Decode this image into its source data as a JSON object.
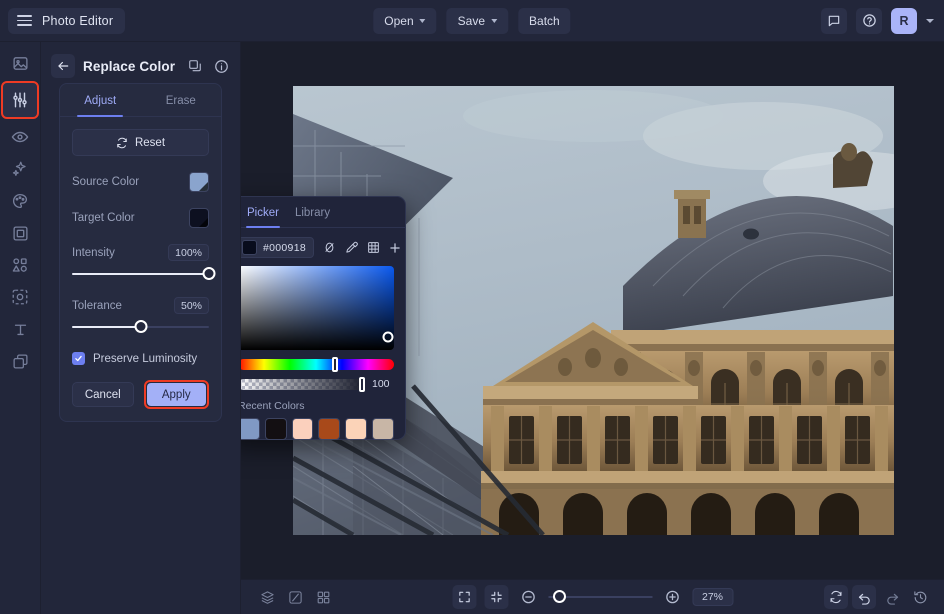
{
  "app": {
    "brand": "Photo Editor",
    "accent": "#6d7ff0",
    "highlight": "#ef3b24",
    "bg": "#22263a",
    "canvas_bg": "#1b1e2b"
  },
  "topbar": {
    "menu_icon": "hamburger-icon",
    "buttons": [
      {
        "label": "Open",
        "has_caret": true
      },
      {
        "label": "Save",
        "has_caret": true
      },
      {
        "label": "Batch",
        "has_caret": false
      }
    ],
    "right_icons": [
      "comment-icon",
      "help-icon"
    ],
    "avatar_initial": "R"
  },
  "rail": {
    "items": [
      {
        "name": "image-icon",
        "active": false
      },
      {
        "name": "adjustments-icon",
        "active": true
      },
      {
        "name": "eye-icon",
        "active": false
      },
      {
        "name": "sparkles-icon",
        "active": false
      },
      {
        "name": "palette-icon",
        "active": false
      },
      {
        "name": "frame-icon",
        "active": false
      },
      {
        "name": "shapes-icon",
        "active": false
      },
      {
        "name": "effects-icon",
        "active": false
      },
      {
        "name": "text-icon",
        "active": false
      },
      {
        "name": "layers-icon",
        "active": false
      }
    ]
  },
  "panel": {
    "title": "Replace Color",
    "back_icon": "arrow-left-icon",
    "duplicate_icon": "duplicate-icon",
    "info_icon": "info-icon",
    "tabs": [
      {
        "label": "Adjust",
        "active": true
      },
      {
        "label": "Erase",
        "active": false
      }
    ],
    "reset_label": "Reset",
    "reset_icon": "refresh-icon",
    "source_color": {
      "label": "Source Color",
      "value": "#8aa4cd"
    },
    "target_color": {
      "label": "Target Color",
      "value": "#0d1020"
    },
    "intensity": {
      "label": "Intensity",
      "value": "100%",
      "percent": 100
    },
    "tolerance": {
      "label": "Tolerance",
      "value": "50%",
      "percent": 50
    },
    "preserve_luminosity": {
      "label": "Preserve Luminosity",
      "checked": true
    },
    "cancel_label": "Cancel",
    "apply_label": "Apply"
  },
  "picker": {
    "tabs": [
      {
        "label": "Picker",
        "active": true
      },
      {
        "label": "Library",
        "active": false
      }
    ],
    "hex": "#000918",
    "swatch_color": "#080c1c",
    "icons": [
      "no-color-icon",
      "eyedropper-icon",
      "grid-icon",
      "plus-icon"
    ],
    "sat_knob": {
      "x_percent": 96,
      "y_percent": 84
    },
    "hue_percent": 62,
    "alpha_value": "100",
    "alpha_percent": 98,
    "recent_title": "Recent Colors",
    "recent_colors": [
      "#8099c4",
      "#130f12",
      "#fbd0bd",
      "#a8491a",
      "#fbd3b8",
      "#c8b6a6"
    ]
  },
  "bottombar": {
    "left_icons": [
      "layers-stack-icon",
      "compare-icon",
      "grid-view-icon"
    ],
    "center_icons": [
      "fit-screen-icon",
      "actual-size-icon",
      "zoom-out-icon",
      "zoom-in-icon"
    ],
    "zoom_value": "27%",
    "zoom_percent": 11,
    "right_icons": [
      "rotate-icon",
      "undo-icon",
      "redo-icon",
      "history-icon"
    ]
  },
  "canvas": {
    "image_alt": "Louvre museum facade with glass pyramid"
  }
}
